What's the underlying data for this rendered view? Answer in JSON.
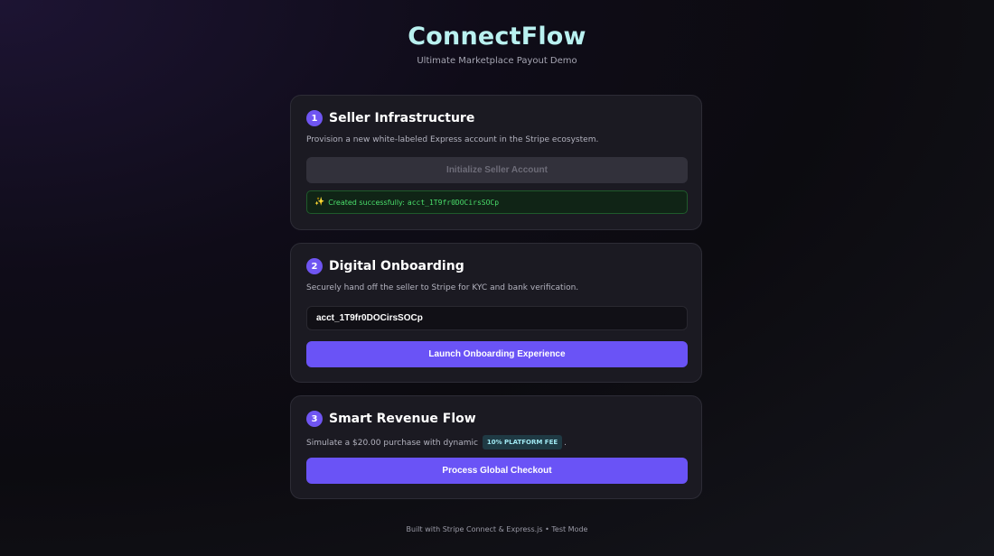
{
  "header": {
    "title": "ConnectFlow",
    "subtitle": "Ultimate Marketplace Payout Demo"
  },
  "step1": {
    "number": "1",
    "title": "Seller Infrastructure",
    "description": "Provision a new white-labeled Express account in the Stripe ecosystem.",
    "button_label": "Initialize Seller Account",
    "success_prefix": "Created successfully:",
    "account_id": "acct_1T9fr0DOCirsSOCp"
  },
  "step2": {
    "number": "2",
    "title": "Digital Onboarding",
    "description": "Securely hand off the seller to Stripe for KYC and bank verification.",
    "account_input_value": "acct_1T9fr0DOCirsSOCp",
    "button_label": "Launch Onboarding Experience"
  },
  "step3": {
    "number": "3",
    "title": "Smart Revenue Flow",
    "description_prefix": "Simulate a $20.00 purchase with dynamic",
    "fee_badge": "10% PLATFORM FEE",
    "description_suffix": ".",
    "button_label": "Process Global Checkout"
  },
  "footer": {
    "text": "Built with Stripe Connect & Express.js • Test Mode"
  },
  "icons": {
    "success": "sparkle-icon"
  },
  "colors": {
    "accent": "#6a53f6",
    "title": "#b9f1f0",
    "success": "#4ade6b"
  }
}
